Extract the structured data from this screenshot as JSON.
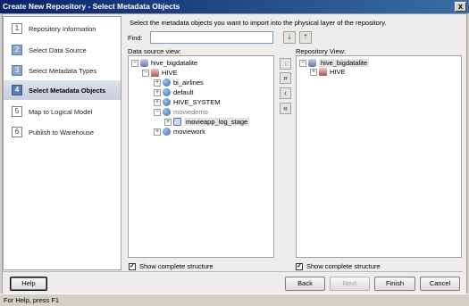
{
  "window": {
    "title": "Create New Repository - Select Metadata Objects",
    "close_glyph": "x"
  },
  "steps": [
    {
      "num": "1",
      "label": "Repository Information"
    },
    {
      "num": "2",
      "label": "Select Data Source"
    },
    {
      "num": "3",
      "label": "Select Metadata Types"
    },
    {
      "num": "4",
      "label": "Select Metadata Objects"
    },
    {
      "num": "5",
      "label": "Map to Logical Model"
    },
    {
      "num": "6",
      "label": "Publish to Warehouse"
    }
  ],
  "instruction": "Select the metadata objects you want to import into the physical layer of the repository.",
  "find": {
    "label": "Find:",
    "value": "",
    "next_glyph": "⇣",
    "prev_glyph": "⇡"
  },
  "data_source": {
    "label": "Data source view:",
    "tree": {
      "root": {
        "expander": "−",
        "label": "hive_bigdatalite"
      },
      "catalog": {
        "expander": "−",
        "label": "HIVE"
      },
      "bi_airlines": {
        "expander": "+",
        "label": "bi_airlines"
      },
      "default": {
        "expander": "+",
        "label": "default"
      },
      "hive_system": {
        "expander": "+",
        "label": "HIVE_SYSTEM"
      },
      "moviedemo": {
        "expander": "−",
        "label": "moviedemo"
      },
      "movieapp_log_stage": {
        "expander": "+",
        "label": "movieapp_log_stage"
      },
      "moviework": {
        "expander": "+",
        "label": "moviework"
      }
    },
    "show_complete": "Show complete structure"
  },
  "move_buttons": {
    "add": "›",
    "add_all": "»",
    "remove": "‹",
    "remove_all": "«"
  },
  "repository": {
    "label": "Repository View:",
    "tree": {
      "root": {
        "expander": "−",
        "label": "hive_bigdatalite"
      },
      "catalog": {
        "expander": "+",
        "label": "HIVE"
      }
    },
    "show_complete": "Show complete structure"
  },
  "checkbox_glyph": "✓",
  "buttons": {
    "help": "Help",
    "back": "Back",
    "next": "Next",
    "finish": "Finish",
    "cancel": "Cancel"
  },
  "status": "For Help, press F1"
}
